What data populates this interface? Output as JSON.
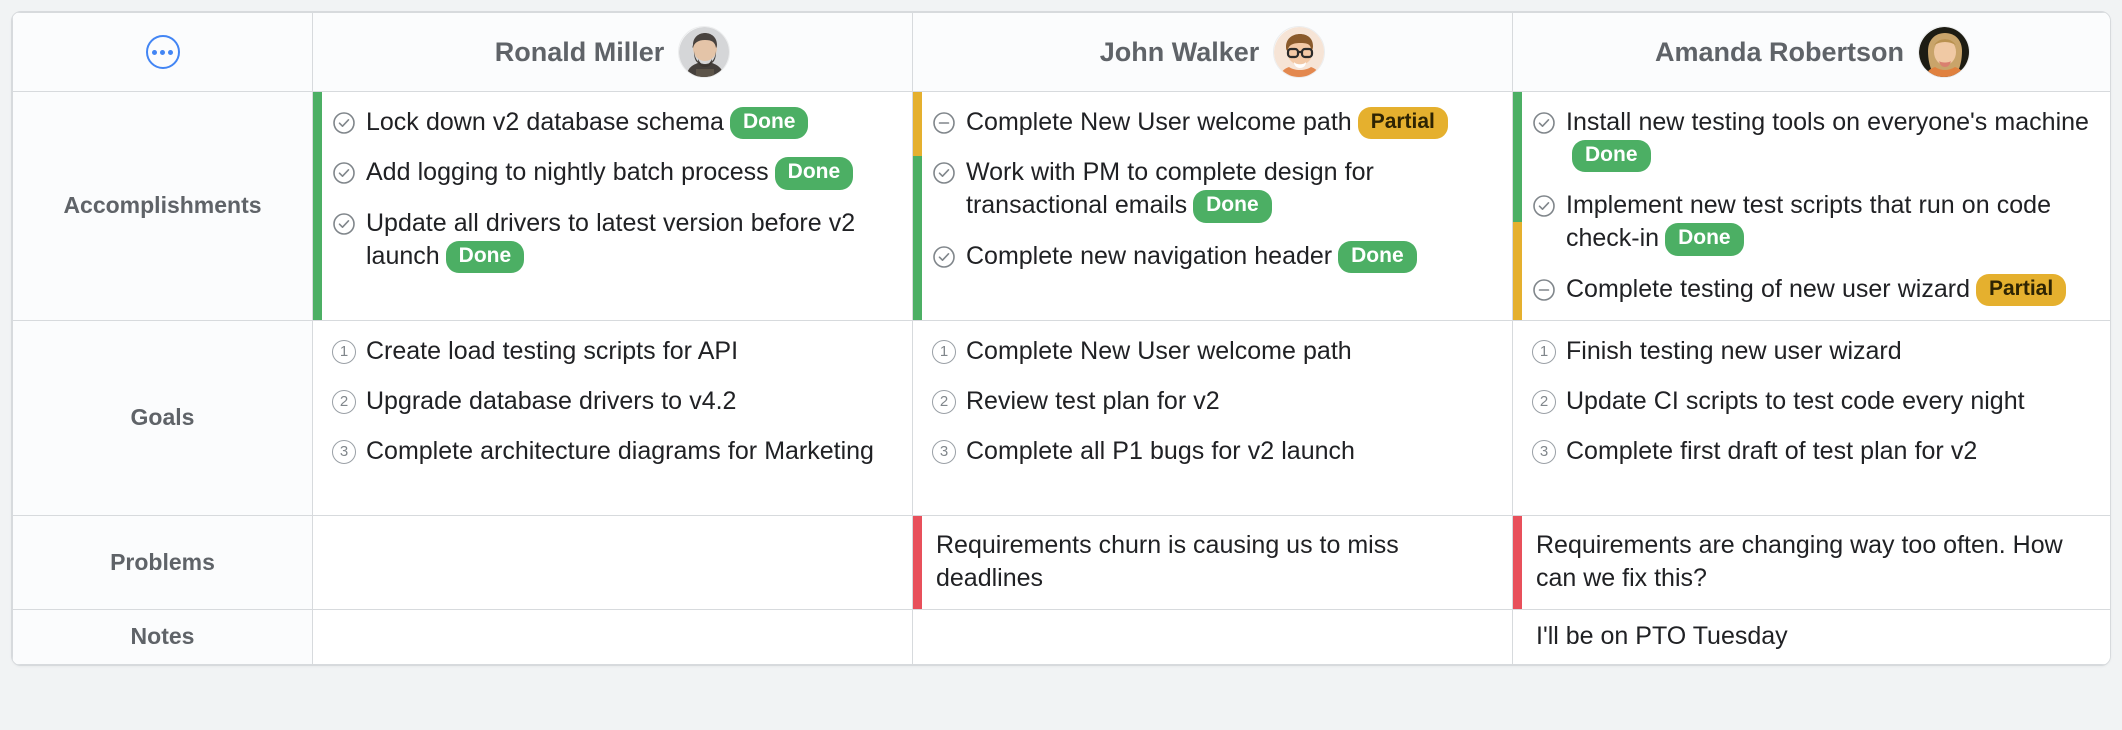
{
  "header": {
    "menu_icon": "more-options-icon",
    "people": [
      {
        "name": "Ronald Miller",
        "avatar": "avatar-ronald-miller"
      },
      {
        "name": "John Walker",
        "avatar": "avatar-john-walker"
      },
      {
        "name": "Amanda Robertson",
        "avatar": "avatar-amanda-robertson"
      }
    ]
  },
  "rows": {
    "accomplishments": {
      "label": "Accomplishments",
      "columns": [
        {
          "person": "Ronald Miller",
          "items": [
            {
              "icon": "check-circle-icon",
              "status": "done",
              "text": "Lock down v2 database schema",
              "badge": "Done",
              "accent": "#4caf64"
            },
            {
              "icon": "check-circle-icon",
              "status": "done",
              "text": "Add logging to nightly batch process",
              "badge": "Done",
              "accent": "#4caf64"
            },
            {
              "icon": "check-circle-icon",
              "status": "done",
              "text": "Update all drivers to latest version before v2 launch",
              "badge": "Done",
              "accent": "#4caf64"
            }
          ]
        },
        {
          "person": "John Walker",
          "items": [
            {
              "icon": "minus-circle-icon",
              "status": "partial",
              "text": "Complete New User welcome path",
              "badge": "Partial",
              "accent": "#e5b02e"
            },
            {
              "icon": "check-circle-icon",
              "status": "done",
              "text": "Work with PM to complete design for transactional emails",
              "badge": "Done",
              "accent": "#4caf64"
            },
            {
              "icon": "check-circle-icon",
              "status": "done",
              "text": "Complete new navigation header",
              "badge": "Done",
              "accent": "#4caf64"
            }
          ]
        },
        {
          "person": "Amanda Robertson",
          "items": [
            {
              "icon": "check-circle-icon",
              "status": "done",
              "text": "Install new testing tools on everyone's machine",
              "badge": "Done",
              "accent": "#4caf64"
            },
            {
              "icon": "check-circle-icon",
              "status": "done",
              "text": "Implement new test scripts that run on code check-in",
              "badge": "Done",
              "accent": "#4caf64"
            },
            {
              "icon": "minus-circle-icon",
              "status": "partial",
              "text": "Complete testing of new user wizard",
              "badge": "Partial",
              "accent": "#e5b02e"
            }
          ]
        }
      ]
    },
    "goals": {
      "label": "Goals",
      "columns": [
        {
          "person": "Ronald Miller",
          "items": [
            {
              "num": "1",
              "text": "Create load testing scripts for API"
            },
            {
              "num": "2",
              "text": "Upgrade database drivers to v4.2"
            },
            {
              "num": "3",
              "text": "Complete architecture diagrams for Marketing"
            }
          ]
        },
        {
          "person": "John Walker",
          "items": [
            {
              "num": "1",
              "text": "Complete New User welcome path"
            },
            {
              "num": "2",
              "text": "Review test plan for v2"
            },
            {
              "num": "3",
              "text": "Complete all P1 bugs for v2 launch"
            }
          ]
        },
        {
          "person": "Amanda Robertson",
          "items": [
            {
              "num": "1",
              "text": "Finish testing new user wizard"
            },
            {
              "num": "2",
              "text": "Update CI scripts to test code every night"
            },
            {
              "num": "3",
              "text": "Complete first draft of test plan for v2"
            }
          ]
        }
      ]
    },
    "problems": {
      "label": "Problems",
      "columns": [
        {
          "person": "Ronald Miller",
          "text": "",
          "accent": ""
        },
        {
          "person": "John Walker",
          "text": "Requirements churn is causing us to miss deadlines",
          "accent": "#e8505b"
        },
        {
          "person": "Amanda Robertson",
          "text": "Requirements are changing way too often. How can we fix this?",
          "accent": "#e8505b"
        }
      ]
    },
    "notes": {
      "label": "Notes",
      "columns": [
        {
          "person": "Ronald Miller",
          "text": "",
          "accent": ""
        },
        {
          "person": "John Walker",
          "text": "",
          "accent": ""
        },
        {
          "person": "Amanda Robertson",
          "text": "I'll be on PTO Tuesday",
          "accent": ""
        }
      ]
    }
  },
  "colors": {
    "done": "#4caf64",
    "partial": "#e5b02e",
    "problem": "#e8505b",
    "accent_blue": "#4285f4",
    "label_text": "#5f6368",
    "body_text": "#202124",
    "border": "#d7dadd",
    "header_bg": "#fbfcfd",
    "page_bg": "#f1f3f4"
  }
}
